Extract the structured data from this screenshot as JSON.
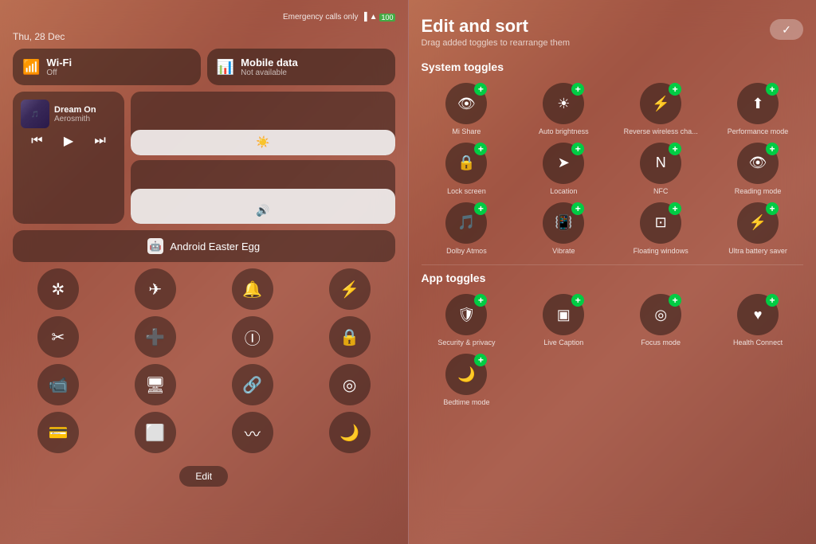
{
  "left": {
    "status": {
      "emergency": "Emergency calls only",
      "date": "Thu, 28 Dec"
    },
    "wifi": {
      "title": "Wi-Fi",
      "sub": "Off",
      "icon": "📶"
    },
    "mobile": {
      "title": "Mobile data",
      "sub": "Not available",
      "icon": "📊"
    },
    "media": {
      "song": "Dream On",
      "artist": "Aerosmith",
      "prev": "⏮",
      "play": "▶",
      "next": "⏭"
    },
    "android_egg": "Android Easter Egg",
    "icons": [
      {
        "name": "bluetooth",
        "symbol": "⚡",
        "unicode": "🔵"
      },
      {
        "name": "airplane",
        "symbol": "✈"
      },
      {
        "name": "bell",
        "symbol": "🔔"
      },
      {
        "name": "flashlight",
        "symbol": "🔦"
      },
      {
        "name": "scissors",
        "symbol": "✂️"
      },
      {
        "name": "health",
        "symbol": "➕"
      },
      {
        "name": "info",
        "symbol": "ℹ"
      },
      {
        "name": "lock-rotate",
        "symbol": "🔒"
      },
      {
        "name": "video",
        "symbol": "📷"
      },
      {
        "name": "screen",
        "symbol": "🖥"
      },
      {
        "name": "link",
        "symbol": "🔗"
      },
      {
        "name": "focus",
        "symbol": "🎯"
      },
      {
        "name": "card",
        "symbol": "💳"
      },
      {
        "name": "scan",
        "symbol": "⬜"
      },
      {
        "name": "waves",
        "symbol": "〰"
      },
      {
        "name": "moon",
        "symbol": "🌙"
      }
    ],
    "edit_label": "Edit"
  },
  "right": {
    "header": {
      "title": "Edit and sort",
      "subtitle": "Drag added toggles to rearrange them",
      "checkmark": "✓"
    },
    "system_section": "System toggles",
    "system_toggles": [
      {
        "name": "Mi Share",
        "symbol": "👁",
        "has_plus": true
      },
      {
        "name": "Auto brightness",
        "symbol": "☀",
        "has_plus": true
      },
      {
        "name": "Reverse wireless cha...",
        "symbol": "⚡",
        "has_plus": true
      },
      {
        "name": "Performance mode",
        "symbol": "⬆",
        "has_plus": true
      },
      {
        "name": "Lock screen",
        "symbol": "🔒",
        "has_plus": true
      },
      {
        "name": "Location",
        "symbol": "➤",
        "has_plus": true
      },
      {
        "name": "NFC",
        "symbol": "N",
        "has_plus": true
      },
      {
        "name": "Reading mode",
        "symbol": "👁",
        "has_plus": true
      },
      {
        "name": "Dolby Atmos",
        "symbol": "🎵",
        "has_plus": true
      },
      {
        "name": "Vibrate",
        "symbol": "📳",
        "has_plus": true
      },
      {
        "name": "Floating windows",
        "symbol": "⬜",
        "has_plus": true
      },
      {
        "name": "Ultra battery saver",
        "symbol": "⚡",
        "has_plus": true
      }
    ],
    "app_section": "App toggles",
    "app_toggles": [
      {
        "name": "Security & privacy",
        "symbol": "🛡",
        "has_plus": true
      },
      {
        "name": "Live Caption",
        "symbol": "▣",
        "has_plus": true
      },
      {
        "name": "Focus mode",
        "symbol": "◎",
        "has_plus": true
      },
      {
        "name": "Health Connect",
        "symbol": "♥",
        "has_plus": true
      },
      {
        "name": "Bedtime mode",
        "symbol": "🌙",
        "has_plus": true
      }
    ]
  }
}
